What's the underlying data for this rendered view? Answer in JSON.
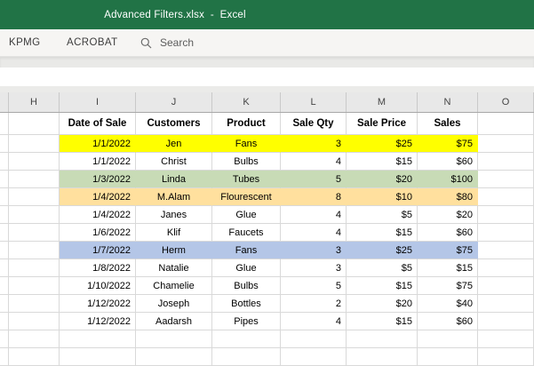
{
  "titlebar": {
    "title": "Advanced Filters.xlsx  -  Excel",
    "bg_color": "#217346"
  },
  "ribbon": {
    "tabs": [
      "KPMG",
      "ACROBAT"
    ],
    "search_label": "Search"
  },
  "grid": {
    "column_letters": [
      "H",
      "I",
      "J",
      "K",
      "L",
      "M",
      "N",
      "O"
    ],
    "table": {
      "headers": [
        "Date of Sale",
        "Customers",
        "Product",
        "Sale Qty",
        "Sale Price",
        "Sales"
      ],
      "rows": [
        {
          "date": "1/1/2022",
          "customer": "Jen",
          "product": "Fans",
          "qty": "3",
          "price": "$25",
          "sales": "$75",
          "highlight": "yellow"
        },
        {
          "date": "1/1/2022",
          "customer": "Christ",
          "product": "Bulbs",
          "qty": "4",
          "price": "$15",
          "sales": "$60",
          "highlight": "none"
        },
        {
          "date": "1/3/2022",
          "customer": "Linda",
          "product": "Tubes",
          "qty": "5",
          "price": "$20",
          "sales": "$100",
          "highlight": "green"
        },
        {
          "date": "1/4/2022",
          "customer": "M.Alam",
          "product": "Flourescent",
          "qty": "8",
          "price": "$10",
          "sales": "$80",
          "highlight": "orange"
        },
        {
          "date": "1/4/2022",
          "customer": "Janes",
          "product": "Glue",
          "qty": "4",
          "price": "$5",
          "sales": "$20",
          "highlight": "none"
        },
        {
          "date": "1/6/2022",
          "customer": "Klif",
          "product": "Faucets",
          "qty": "4",
          "price": "$15",
          "sales": "$60",
          "highlight": "none"
        },
        {
          "date": "1/7/2022",
          "customer": "Herm",
          "product": "Fans",
          "qty": "3",
          "price": "$25",
          "sales": "$75",
          "highlight": "blue"
        },
        {
          "date": "1/8/2022",
          "customer": "Natalie",
          "product": "Glue",
          "qty": "3",
          "price": "$5",
          "sales": "$15",
          "highlight": "none"
        },
        {
          "date": "1/10/2022",
          "customer": "Chamelie",
          "product": "Bulbs",
          "qty": "5",
          "price": "$15",
          "sales": "$75",
          "highlight": "none"
        },
        {
          "date": "1/12/2022",
          "customer": "Joseph",
          "product": "Bottles",
          "qty": "2",
          "price": "$20",
          "sales": "$40",
          "highlight": "none"
        },
        {
          "date": "1/12/2022",
          "customer": "Aadarsh",
          "product": "Pipes",
          "qty": "4",
          "price": "$15",
          "sales": "$60",
          "highlight": "none"
        }
      ],
      "empty_row_count": 2
    },
    "highlight_colors": {
      "yellow": "#ffff00",
      "green": "#c8dbb6",
      "orange": "#ffe09e",
      "blue": "#b4c6e7",
      "none": "#ffffff"
    }
  }
}
